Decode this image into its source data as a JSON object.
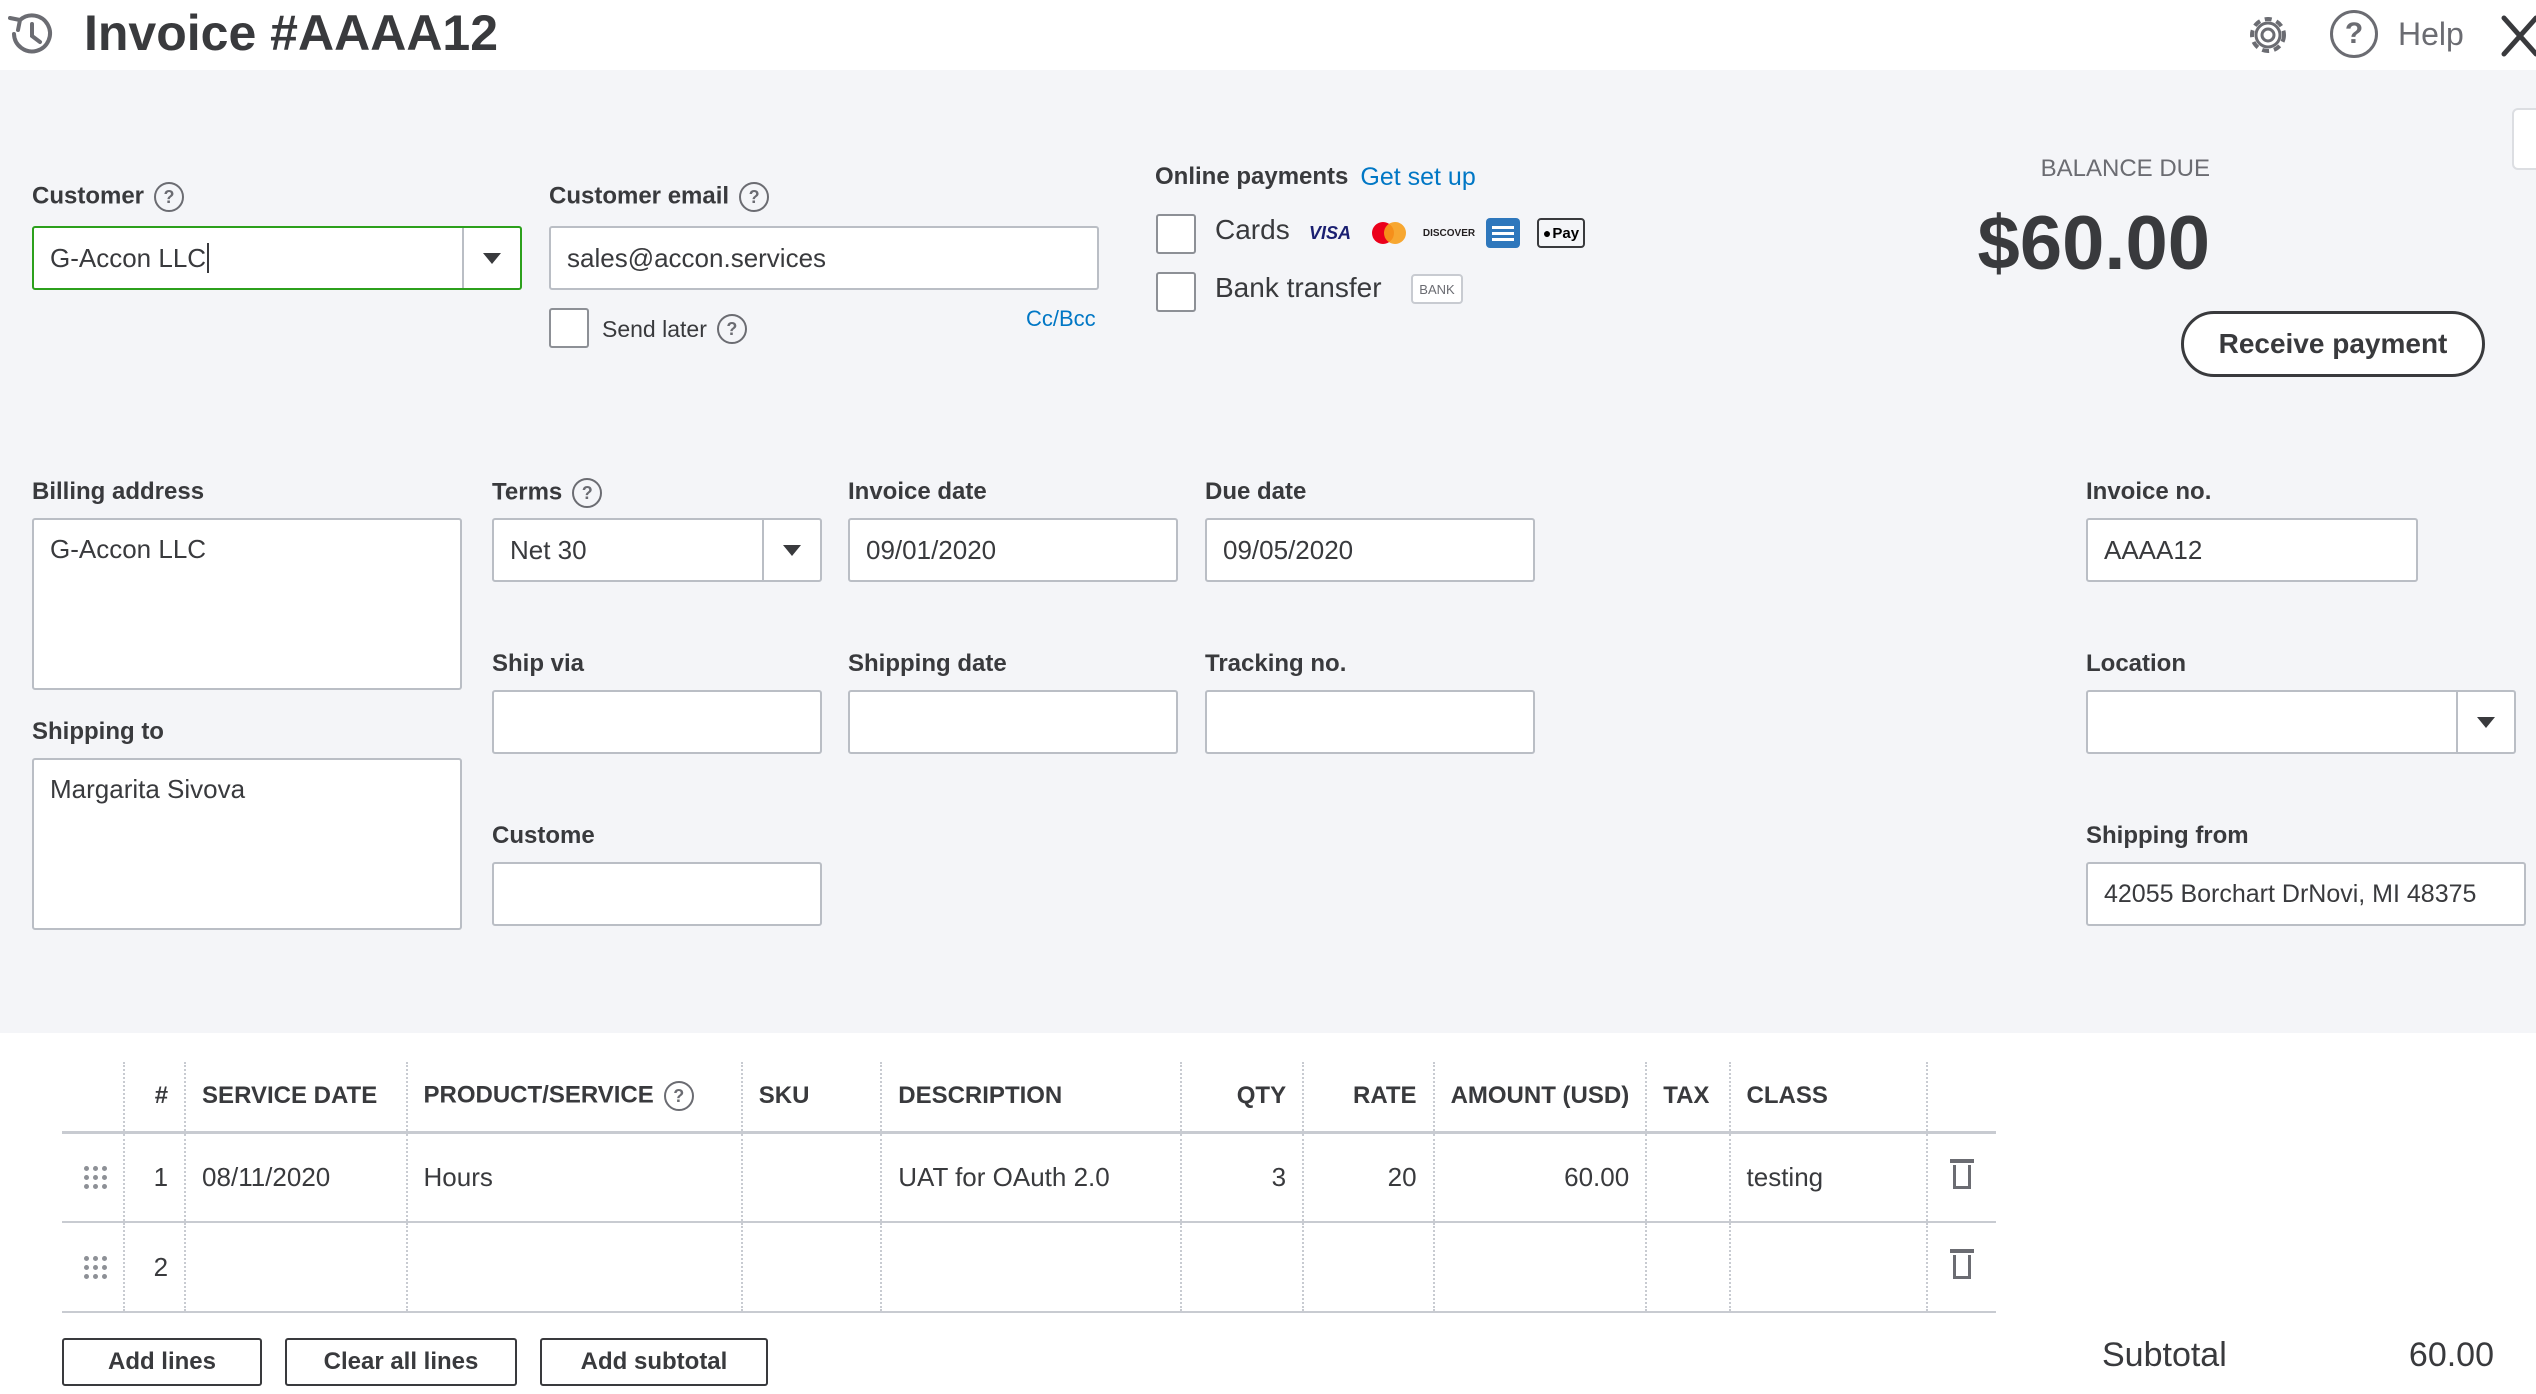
{
  "header": {
    "title": "Invoice #AAAA12",
    "help_label": "Help",
    "icons": [
      "history-icon",
      "gear-icon",
      "help-icon",
      "close-icon"
    ]
  },
  "customer": {
    "label": "Customer",
    "value": "G-Accon LLC"
  },
  "email": {
    "label": "Customer email",
    "value": "sales@accon.services",
    "send_later": "Send later",
    "cc_bcc": "Cc/Bcc"
  },
  "online_payments": {
    "label": "Online payments",
    "setup_link": "Get set up",
    "cards_label": "Cards",
    "card_logos": {
      "visa": "VISA",
      "discover": "DISCOVER",
      "applepay": "Pay"
    },
    "bank_label": "Bank transfer",
    "bank_logo": "BANK"
  },
  "balance": {
    "label": "BALANCE DUE",
    "amount": "$60.00",
    "receive_button": "Receive payment"
  },
  "billing": {
    "label": "Billing address",
    "value": "G-Accon LLC"
  },
  "shipping_to": {
    "label": "Shipping to",
    "value": "Margarita Sivova"
  },
  "terms": {
    "label": "Terms",
    "value": "Net 30"
  },
  "invoice_date": {
    "label": "Invoice date",
    "value": "09/01/2020"
  },
  "due_date": {
    "label": "Due date",
    "value": "09/05/2020"
  },
  "invoice_no": {
    "label": "Invoice no.",
    "value": "AAAA12"
  },
  "ship_via": {
    "label": "Ship via",
    "value": ""
  },
  "shipping_date": {
    "label": "Shipping date",
    "value": ""
  },
  "tracking_no": {
    "label": "Tracking no.",
    "value": ""
  },
  "location": {
    "label": "Location",
    "value": ""
  },
  "custom": {
    "label": "Custome",
    "value": ""
  },
  "shipping_from": {
    "label": "Shipping from",
    "value": "42055 Borchart DrNovi, MI  48375"
  },
  "table": {
    "headers": {
      "num": "#",
      "service_date": "SERVICE DATE",
      "product": "PRODUCT/SERVICE",
      "sku": "SKU",
      "description": "DESCRIPTION",
      "qty": "QTY",
      "rate": "RATE",
      "amount": "AMOUNT (USD)",
      "tax": "TAX",
      "class": "CLASS"
    },
    "rows": [
      {
        "num": "1",
        "service_date": "08/11/2020",
        "product": "Hours",
        "sku": "",
        "description": "UAT for OAuth 2.0",
        "qty": "3",
        "rate": "20",
        "amount": "60.00",
        "tax": "",
        "class": "testing"
      },
      {
        "num": "2",
        "service_date": "",
        "product": "",
        "sku": "",
        "description": "",
        "qty": "",
        "rate": "",
        "amount": "",
        "tax": "",
        "class": ""
      }
    ]
  },
  "actions": {
    "add_lines": "Add lines",
    "clear_lines": "Clear all lines",
    "add_subtotal": "Add subtotal"
  },
  "subtotal": {
    "label": "Subtotal",
    "value": "60.00"
  },
  "colors": {
    "accent_green": "#2ca01c",
    "link_blue": "#0077c5",
    "text": "#393a3d",
    "form_bg": "#f4f5f8"
  }
}
